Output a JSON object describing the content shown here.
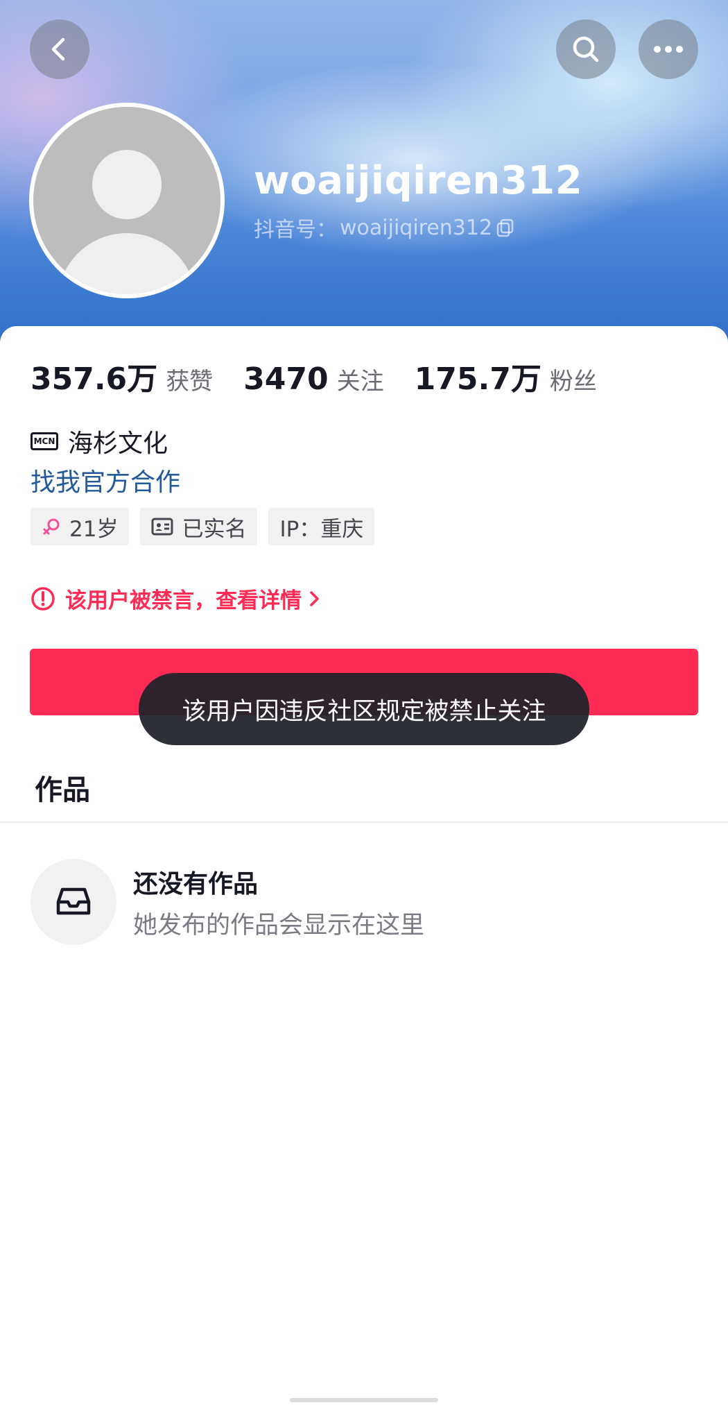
{
  "header": {
    "username": "woaijiqiren312",
    "douyin_id_label": "抖音号：",
    "douyin_id": "woaijiqiren312",
    "icons": [
      "chevron-left-icon",
      "search-icon",
      "more-icon",
      "copy-icon"
    ]
  },
  "stats": [
    {
      "value": "357.6万",
      "label": "获赞"
    },
    {
      "value": "3470",
      "label": "关注"
    },
    {
      "value": "175.7万",
      "label": "粉丝"
    }
  ],
  "mcn": {
    "badge": "MCN",
    "name": "海杉文化"
  },
  "cooperation_link": "找我官方合作",
  "tags": {
    "age": "21岁",
    "verified": "已实名",
    "ip": "IP：重庆"
  },
  "ban_notice": "该用户被禁言，查看详情",
  "toast": "该用户因违反社区规定被禁止关注",
  "tabs": {
    "works": "作品"
  },
  "empty_state": {
    "title": "还没有作品",
    "description": "她发布的作品会显示在这里"
  },
  "colors": {
    "accent": "#fe2c55",
    "link": "#23589a",
    "female_icon": "#f24e9b",
    "toast_bg": "#21232a"
  }
}
